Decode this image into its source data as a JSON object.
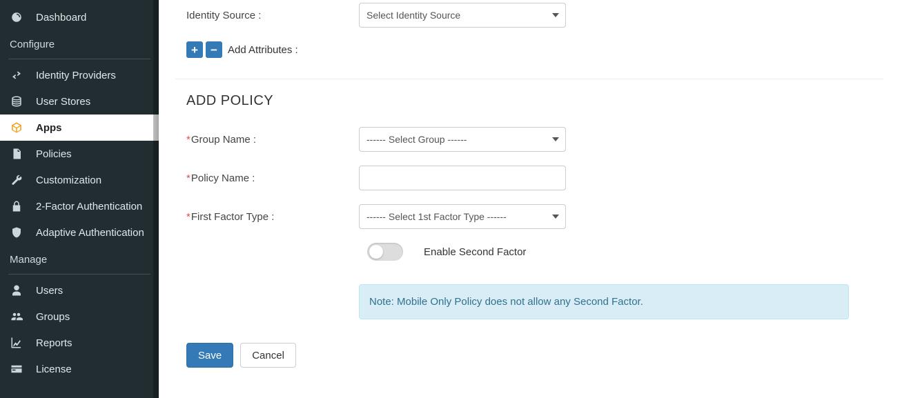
{
  "sidebar": {
    "heading_configure": "Configure",
    "heading_manage": "Manage",
    "items_top": [
      {
        "label": "Dashboard"
      }
    ],
    "items_configure": [
      {
        "label": "Identity Providers"
      },
      {
        "label": "User Stores"
      },
      {
        "label": "Apps"
      },
      {
        "label": "Policies"
      },
      {
        "label": "Customization"
      },
      {
        "label": "2-Factor Authentication"
      },
      {
        "label": "Adaptive Authentication"
      }
    ],
    "items_manage": [
      {
        "label": "Users"
      },
      {
        "label": "Groups"
      },
      {
        "label": "Reports"
      },
      {
        "label": "License"
      }
    ]
  },
  "form_top": {
    "identity_source_label": "Identity Source :",
    "identity_source_placeholder": "Select Identity Source",
    "add_attributes_label": "Add Attributes :"
  },
  "policy": {
    "section_title": "ADD POLICY",
    "group_name_label": "Group Name :",
    "group_name_placeholder": "------ Select Group ------",
    "policy_name_label": "Policy Name :",
    "first_factor_label": "First Factor Type :",
    "first_factor_placeholder": "------ Select 1st Factor Type ------",
    "enable_second_factor_label": "Enable Second Factor",
    "note_text": "Note: Mobile Only Policy does not allow any Second Factor."
  },
  "actions": {
    "save": "Save",
    "cancel": "Cancel"
  }
}
